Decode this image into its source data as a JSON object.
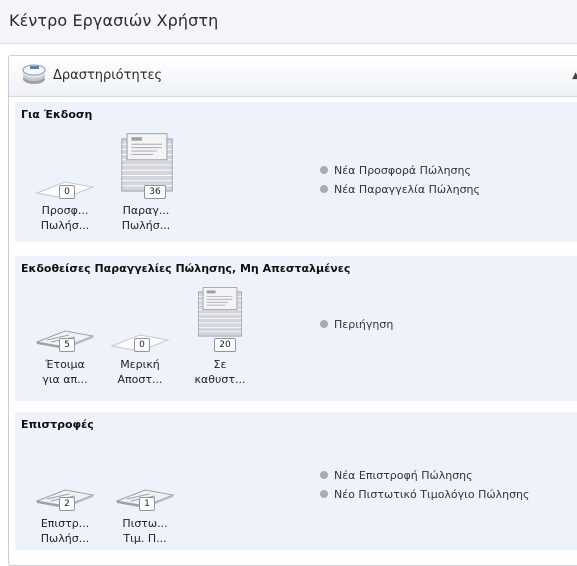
{
  "window": {
    "title": "Κέντρο Εργασιών Χρήστη"
  },
  "activities": {
    "title": "Δραστηριότητες",
    "icon": "documents-stack-icon",
    "collapse_icon": "collapse-arrow-icon",
    "sections": [
      {
        "title": "Για Έκδοση",
        "tiles": [
          {
            "count": "0",
            "label1": "Προσφ...",
            "label2": "Πωλήσ..."
          },
          {
            "count": "36",
            "label1": "Παραγ...",
            "label2": "Πωλήσ..."
          }
        ],
        "actions": [
          "Νέα Προσφορά Πώλησης",
          "Νέα Παραγγελία Πώλησης"
        ]
      },
      {
        "title": "Εκδοθείσες Παραγγελίες Πώλησης, Μη Απεσταλμένες",
        "tiles": [
          {
            "count": "5",
            "label1": "Έτοιμα",
            "label2": "για απ..."
          },
          {
            "count": "0",
            "label1": "Μερική",
            "label2": "Αποστ..."
          },
          {
            "count": "20",
            "label1": "Σε",
            "label2": "καθυστ..."
          }
        ],
        "actions": [
          "Περιήγηση"
        ]
      },
      {
        "title": "Επιστροφές",
        "tiles": [
          {
            "count": "2",
            "label1": "Επιστρ...",
            "label2": "Πωλήσ..."
          },
          {
            "count": "1",
            "label1": "Πιστω...",
            "label2": "Τιμ. Π..."
          }
        ],
        "actions": [
          "Νέα Επιστροφή Πώλησης",
          "Νέο Πιστωτικό Τιμολόγιο Πώλησης"
        ]
      }
    ]
  },
  "colors": {
    "section_bg": "#eef3fb",
    "bullet": "#a7acb3",
    "border": "#c9ced8"
  }
}
